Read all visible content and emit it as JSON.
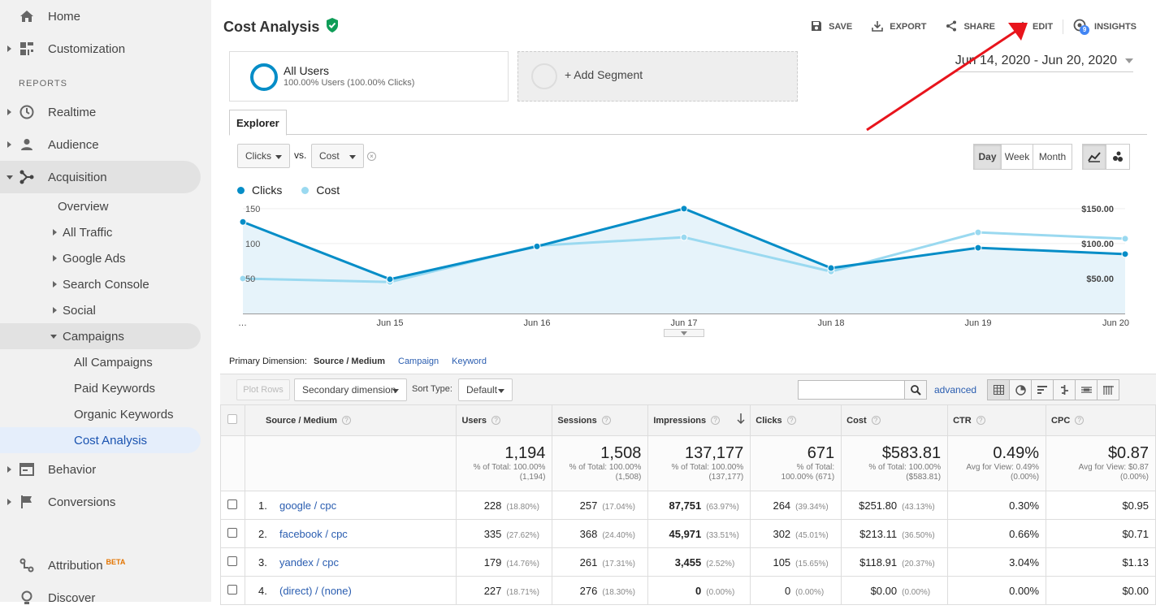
{
  "sidebar": {
    "home": "Home",
    "customization": "Customization",
    "reports_header": "REPORTS",
    "realtime": "Realtime",
    "audience": "Audience",
    "acquisition": "Acquisition",
    "overview": "Overview",
    "all_traffic": "All Traffic",
    "google_ads": "Google Ads",
    "search_console": "Search Console",
    "social": "Social",
    "campaigns": "Campaigns",
    "all_campaigns": "All Campaigns",
    "paid_keywords": "Paid Keywords",
    "organic_keywords": "Organic Keywords",
    "cost_analysis": "Cost Analysis",
    "behavior": "Behavior",
    "conversions": "Conversions",
    "attribution": "Attribution",
    "attribution_badge": "BETA",
    "discover": "Discover"
  },
  "header": {
    "title": "Cost Analysis",
    "save": "SAVE",
    "export": "EXPORT",
    "share": "SHARE",
    "edit": "EDIT",
    "insights": "INSIGHTS",
    "insights_count": "9"
  },
  "segments": {
    "current_name": "All Users",
    "current_detail": "100.00% Users (100.00% Clicks)",
    "add_label": "+ Add Segment"
  },
  "date_range": "Jun 14, 2020 - Jun 20, 2020",
  "explorer": {
    "tab": "Explorer",
    "metric1": "Clicks",
    "vs": "vs.",
    "metric2": "Cost",
    "day": "Day",
    "week": "Week",
    "month": "Month"
  },
  "colors": {
    "clicks": "#058dc7",
    "cost": "#9ad9f0",
    "link": "#2a5db0",
    "accent_red": "#e8141c"
  },
  "chart_data": {
    "type": "line",
    "categories": [
      "…",
      "Jun 15",
      "Jun 16",
      "Jun 17",
      "Jun 18",
      "Jun 19",
      "Jun 20"
    ],
    "series": [
      {
        "name": "Clicks",
        "values": [
          131,
          49,
          96,
          150,
          65,
          94,
          85
        ],
        "axis": "left"
      },
      {
        "name": "Cost",
        "values": [
          50.0,
          45.0,
          97.0,
          109.0,
          60.0,
          116.0,
          107.0
        ],
        "axis": "right"
      }
    ],
    "y_left_ticks": [
      "150",
      "100",
      "50"
    ],
    "y_right_ticks": [
      "$150.00",
      "$100.00",
      "$50.00"
    ],
    "ylim": [
      0,
      150
    ]
  },
  "primary_dimension": {
    "label": "Primary Dimension:",
    "current": "Source / Medium",
    "opt1": "Campaign",
    "opt2": "Keyword"
  },
  "toolbar": {
    "plot_rows": "Plot Rows",
    "secondary": "Secondary dimension",
    "sort_type_label": "Sort Type:",
    "sort_value": "Default",
    "advanced": "advanced"
  },
  "table": {
    "headers": [
      "Source / Medium",
      "Users",
      "Sessions",
      "Impressions",
      "Clicks",
      "Cost",
      "CTR",
      "CPC"
    ],
    "totals": [
      {
        "big": "1,194",
        "l1": "% of Total: 100.00%",
        "l2": "(1,194)"
      },
      {
        "big": "1,508",
        "l1": "% of Total: 100.00%",
        "l2": "(1,508)"
      },
      {
        "big": "137,177",
        "l1": "% of Total: 100.00%",
        "l2": "(137,177)"
      },
      {
        "big": "671",
        "l1": "% of Total:",
        "l2": "100.00% (671)"
      },
      {
        "big": "$583.81",
        "l1": "% of Total: 100.00%",
        "l2": "($583.81)"
      },
      {
        "big": "0.49%",
        "l1": "Avg for View: 0.49%",
        "l2": "(0.00%)"
      },
      {
        "big": "$0.87",
        "l1": "Avg for View: $0.87",
        "l2": "(0.00%)"
      }
    ],
    "rows": [
      {
        "n": "1.",
        "src": "google / cpc",
        "users": "228",
        "users_p": "(18.80%)",
        "sessions": "257",
        "sessions_p": "(17.04%)",
        "impr": "87,751",
        "impr_p": "(63.97%)",
        "clicks": "264",
        "clicks_p": "(39.34%)",
        "cost": "$251.80",
        "cost_p": "(43.13%)",
        "ctr": "0.30%",
        "cpc": "$0.95"
      },
      {
        "n": "2.",
        "src": "facebook / cpc",
        "users": "335",
        "users_p": "(27.62%)",
        "sessions": "368",
        "sessions_p": "(24.40%)",
        "impr": "45,971",
        "impr_p": "(33.51%)",
        "clicks": "302",
        "clicks_p": "(45.01%)",
        "cost": "$213.11",
        "cost_p": "(36.50%)",
        "ctr": "0.66%",
        "cpc": "$0.71"
      },
      {
        "n": "3.",
        "src": "yandex / cpc",
        "users": "179",
        "users_p": "(14.76%)",
        "sessions": "261",
        "sessions_p": "(17.31%)",
        "impr": "3,455",
        "impr_p": "(2.52%)",
        "clicks": "105",
        "clicks_p": "(15.65%)",
        "cost": "$118.91",
        "cost_p": "(20.37%)",
        "ctr": "3.04%",
        "cpc": "$1.13"
      },
      {
        "n": "4.",
        "src": "(direct) / (none)",
        "users": "227",
        "users_p": "(18.71%)",
        "sessions": "276",
        "sessions_p": "(18.30%)",
        "impr": "0",
        "impr_p": "(0.00%)",
        "clicks": "0",
        "clicks_p": "(0.00%)",
        "cost": "$0.00",
        "cost_p": "(0.00%)",
        "ctr": "0.00%",
        "cpc": "$0.00"
      }
    ]
  }
}
